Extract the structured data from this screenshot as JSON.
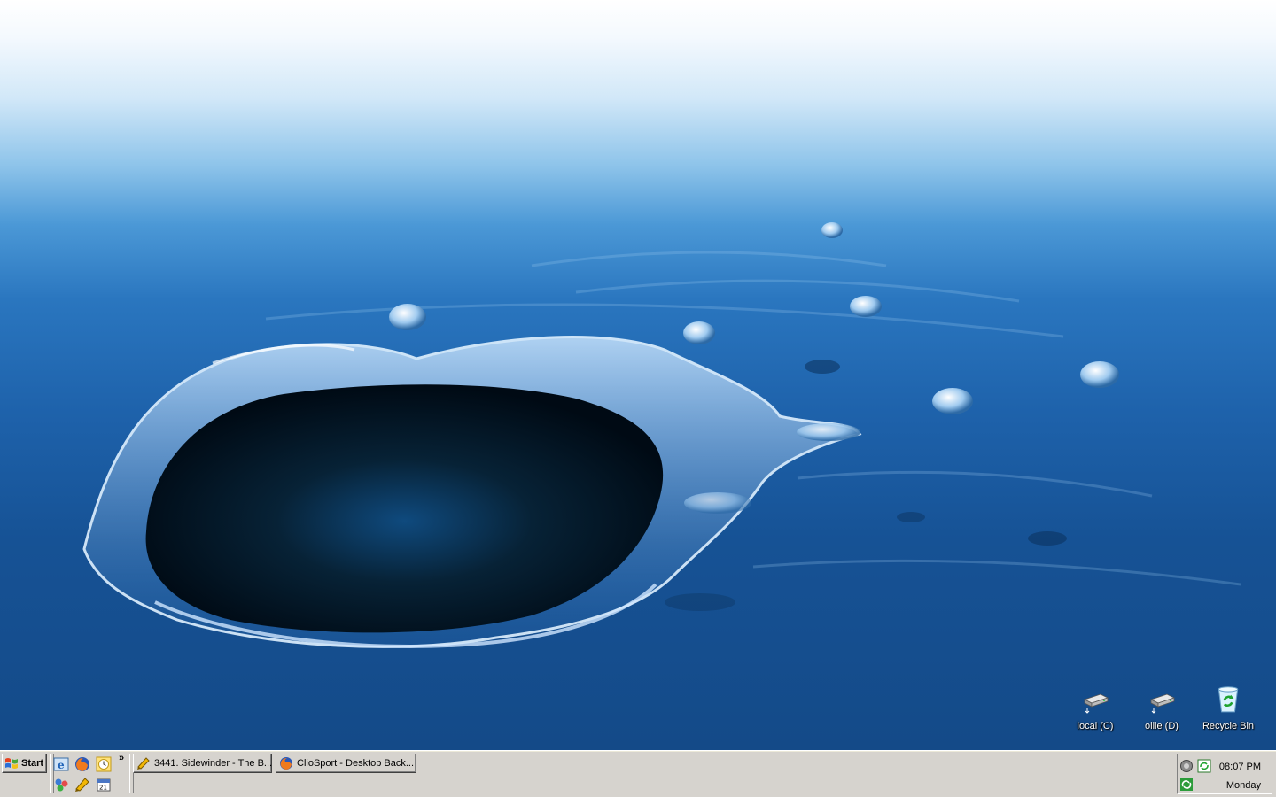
{
  "desktop": {
    "icons": [
      {
        "label": "local (C)",
        "icon": "hard-drive-icon"
      },
      {
        "label": "ollie (D)",
        "icon": "hard-drive-icon"
      },
      {
        "label": "Recycle Bin",
        "icon": "recycle-bin-icon"
      }
    ]
  },
  "taskbar": {
    "start_label": "Start",
    "chevron": "»",
    "quick_launch": [
      "ie-icon",
      "firefox-icon",
      "clock-icon",
      "network-icon",
      "media-icon",
      "calendar-icon"
    ],
    "tasks": [
      {
        "label": "3441. Sidewinder - The B...",
        "icon": "pencil-app-icon"
      },
      {
        "label": "ClioSport - Desktop Back...",
        "icon": "firefox-icon"
      }
    ],
    "tray": {
      "time": "08:07 PM",
      "day": "Monday",
      "icons": [
        "volume-icon",
        "sync-icon",
        "network-status-icon"
      ]
    }
  },
  "colors": {
    "taskbar": "#d6d3ce",
    "accent_blue": "#1e62ab"
  }
}
